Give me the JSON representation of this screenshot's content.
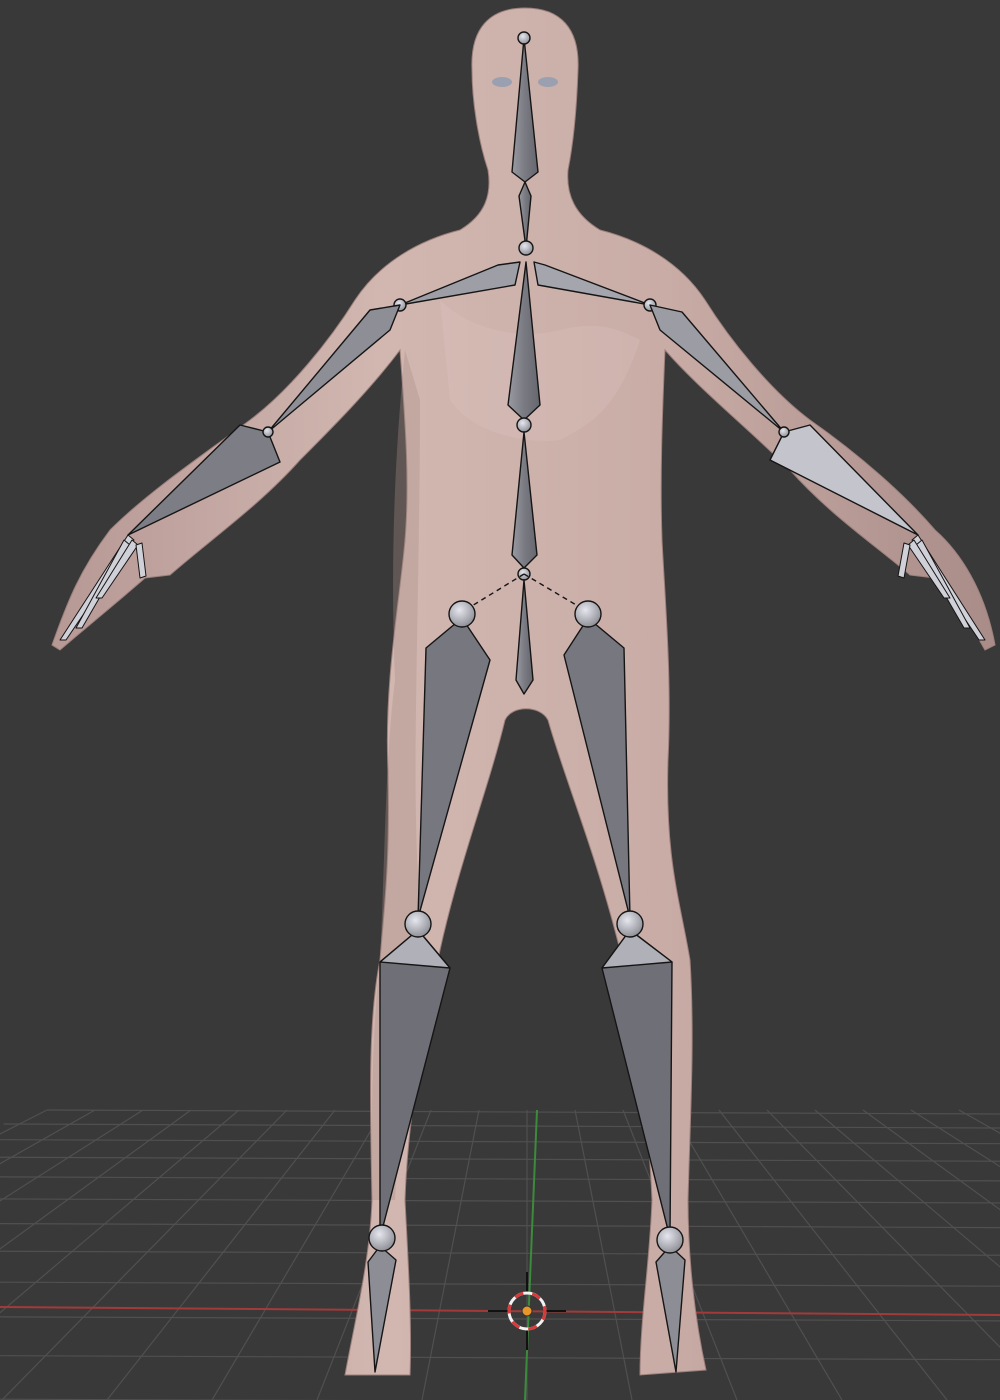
{
  "viewport": {
    "background": "#393939",
    "grid_color": "#505050",
    "x_axis_color": "#a33a3a",
    "y_axis_color": "#3c8a3c"
  },
  "mesh": {
    "skin_color": "#c8aba7",
    "shadow_color": "#a08581"
  },
  "armature": {
    "bone_fill": "#7d7d84",
    "bone_light": "#b4b4bc",
    "outline": "#151515",
    "bones": [
      "head",
      "neck",
      "shoulder-left",
      "shoulder-right",
      "upper-arm-left",
      "upper-arm-right",
      "forearm-left",
      "forearm-right",
      "hand-left",
      "hand-right",
      "spine-upper",
      "spine-lower",
      "pelvis",
      "thigh-left",
      "thigh-right",
      "shin-left",
      "shin-right",
      "foot-left",
      "foot-right"
    ]
  },
  "cursor": {
    "icon": "3d-cursor-icon",
    "ring_color_a": "#d63a3a",
    "ring_color_b": "#f2f2f2",
    "origin_color": "#e8952a"
  }
}
